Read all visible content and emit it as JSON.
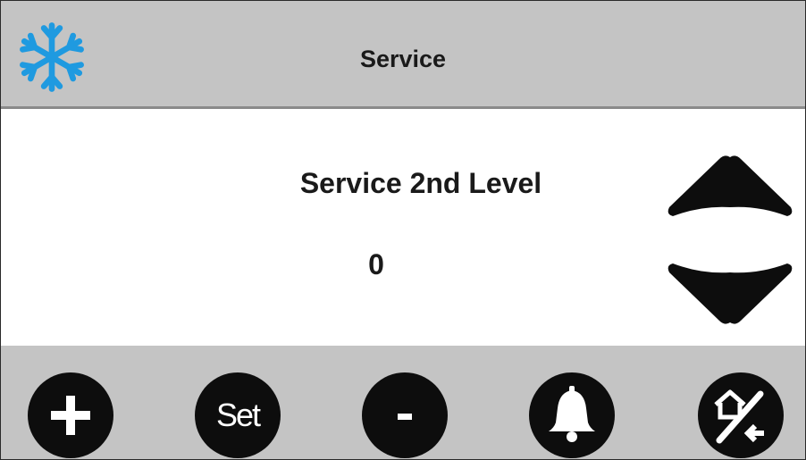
{
  "header": {
    "title": "Service",
    "logo_icon": "snowflake-icon",
    "logo_color": "#1f9ae0"
  },
  "main": {
    "parameter_label": "Service 2nd Level",
    "parameter_value": "0",
    "up_icon": "chevron-up-icon",
    "down_icon": "chevron-down-icon"
  },
  "footer": {
    "buttons": [
      {
        "name": "plus",
        "icon": "plus-icon"
      },
      {
        "name": "set",
        "label": "Set"
      },
      {
        "name": "minus",
        "icon": "minus-icon"
      },
      {
        "name": "alarm",
        "icon": "bell-icon"
      },
      {
        "name": "home-back",
        "icon": "home-back-icon"
      }
    ]
  },
  "colors": {
    "bar": "#c4c4c4",
    "button": "#0d0d0d",
    "text": "#1a1a1a"
  }
}
